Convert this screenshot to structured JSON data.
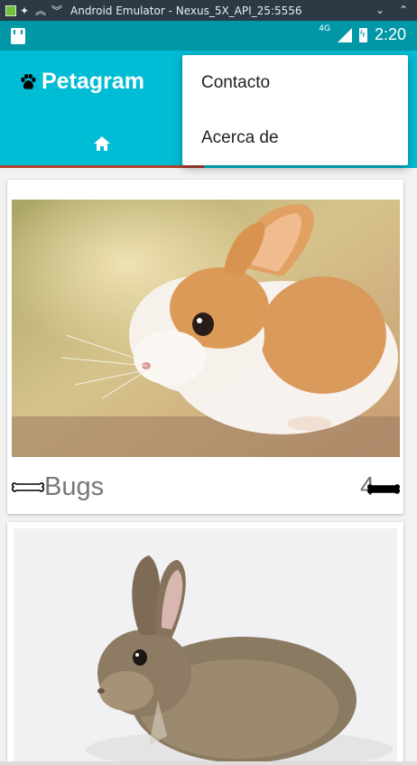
{
  "window": {
    "title": "Android Emulator - Nexus_5X_API_25:5556"
  },
  "status_bar": {
    "network": "4G",
    "time": "2:20"
  },
  "app_bar": {
    "title": "Petagram",
    "brand_icon": "paw-icon",
    "tab_icon": "home-icon",
    "accent_color": "#00bcd4",
    "status_color": "#0097a7"
  },
  "overflow_menu": {
    "items": [
      {
        "label": "Contacto"
      },
      {
        "label": "Acerca de"
      }
    ]
  },
  "pets": [
    {
      "name": "Bugs",
      "likes": "4"
    }
  ]
}
